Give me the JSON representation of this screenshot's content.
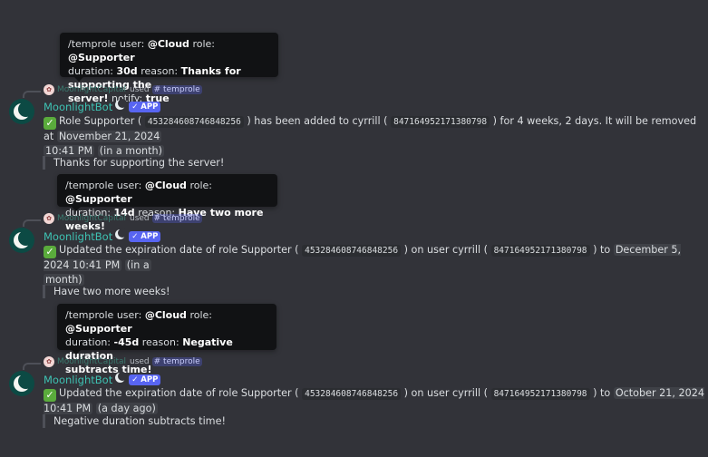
{
  "bot": {
    "name": "MoonlightBot",
    "badge": "✓ APP",
    "invoker": "MoonlightCapital",
    "used_label": "used",
    "command": "# temprole"
  },
  "messages": [
    {
      "tooltip": {
        "line1_cmd": "/temprole user:",
        "user": "@Cloud",
        "role_label": "role:",
        "role": "@Supporter",
        "duration_label": "duration:",
        "duration": "30d",
        "reason_label": "reason:",
        "reason_a": "Thanks for supporting the",
        "reason_b": "server!",
        "notify_label": "notify:",
        "notify": "true"
      },
      "body": {
        "p1": "Role Supporter (",
        "role_id": "453284608746848256",
        "p2": ") has been added to cyrrill (",
        "user_id": "847164952171380798",
        "p3": ") for 4 weeks, 2 days. It will be removed at",
        "ts_a": "November 21, 2024",
        "ts_b": "10:41 PM",
        "rel": "(in a month)"
      },
      "quote": "Thanks for supporting the server!"
    },
    {
      "tooltip": {
        "line1_cmd": "/temprole user:",
        "user": "@Cloud",
        "role_label": "role:",
        "role": "@Supporter",
        "duration_label": "duration:",
        "duration": "14d",
        "reason_label": "reason:",
        "reason_a": "Have two more weeks!"
      },
      "body": {
        "p1": "Updated the expiration date of role Supporter (",
        "role_id": "453284608746848256",
        "p2": ") on user cyrrill (",
        "user_id": "847164952171380798",
        "p3": ") to",
        "ts": "December 5, 2024 10:41 PM",
        "rel_a": "(in a",
        "rel_b": "month)"
      },
      "quote": "Have two more weeks!"
    },
    {
      "tooltip": {
        "line1_cmd": "/temprole user:",
        "user": "@Cloud",
        "role_label": "role:",
        "role": "@Supporter",
        "duration_label": "duration:",
        "duration": "-45d",
        "reason_label": "reason:",
        "reason_a": "Negative duration",
        "reason_b": "subtracts time!"
      },
      "body": {
        "p1": "Updated the expiration date of role Supporter (",
        "role_id": "453284608746848256",
        "p2": ") on user cyrrill (",
        "user_id": "847164952171380798",
        "p3": ") to",
        "ts": "October 21, 2024 10:41 PM",
        "rel": "(a day ago)"
      },
      "quote": "Negative duration subtracts time!"
    }
  ],
  "icons": {
    "check": "white-check-mark-icon",
    "moon": "crescent-moon-icon"
  },
  "colors": {
    "background": "#323339",
    "tooltip": "#111214",
    "bot_name": "#3ec2b3",
    "app_badge": "#5865f2",
    "check": "#5aab3c"
  }
}
